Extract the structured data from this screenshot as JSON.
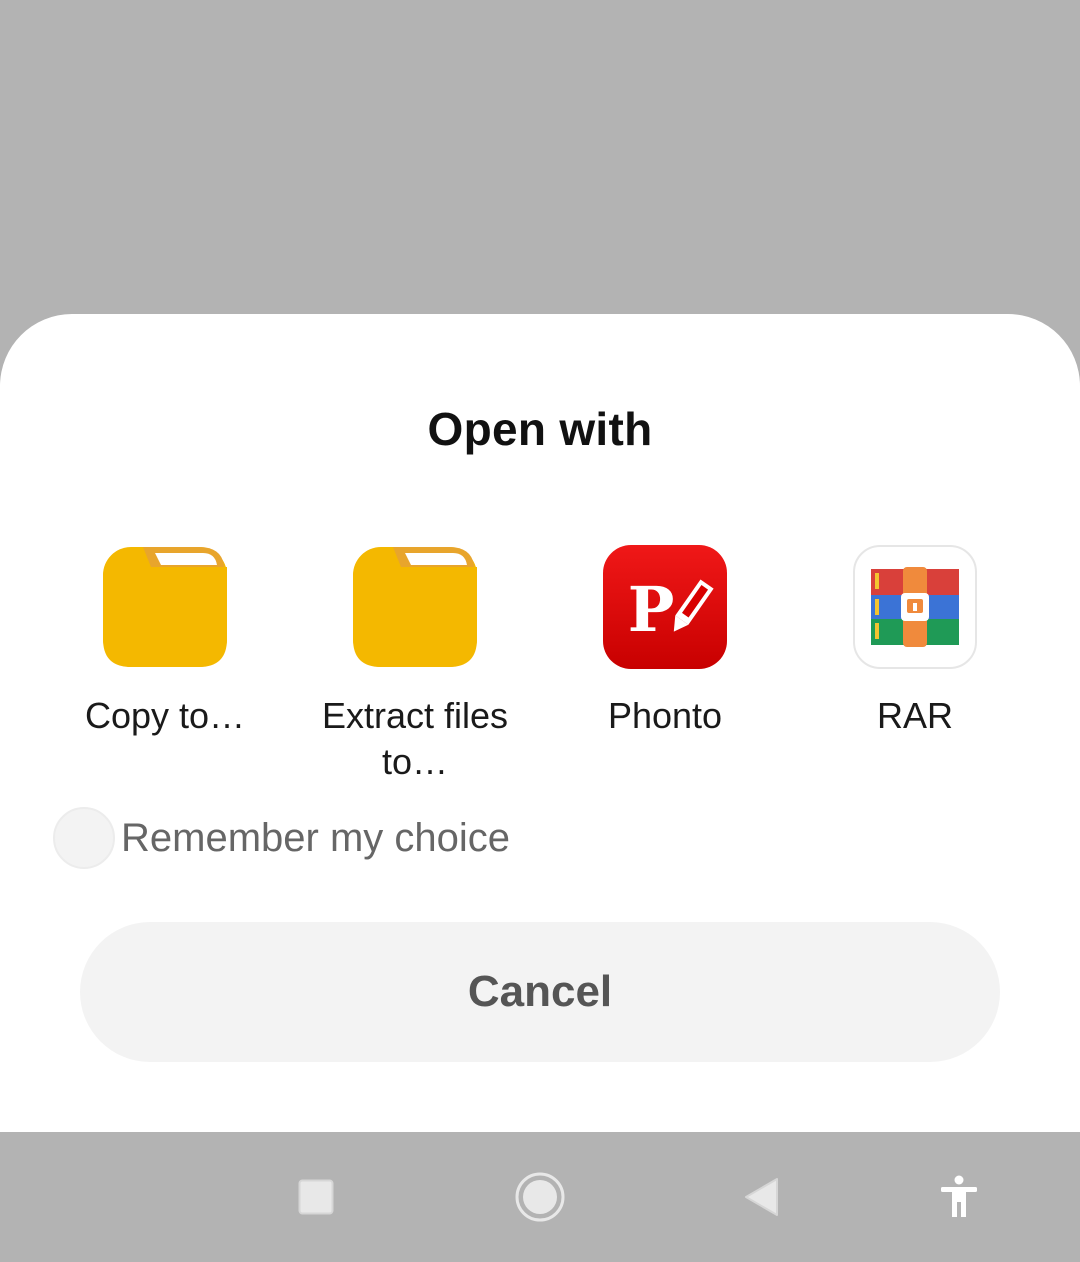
{
  "dialog": {
    "title": "Open with"
  },
  "apps": [
    {
      "label": "Copy to…",
      "icon": "folder-icon"
    },
    {
      "label": "Extract files to…",
      "icon": "folder-icon"
    },
    {
      "label": "Phonto",
      "icon": "phonto-app-icon"
    },
    {
      "label": "RAR",
      "icon": "rar-app-icon"
    }
  ],
  "remember": {
    "label": "Remember my choice",
    "checked": false
  },
  "cancel": {
    "label": "Cancel"
  },
  "navbar": {
    "buttons": [
      "recents-icon",
      "home-icon",
      "back-icon",
      "accessibility-icon"
    ]
  },
  "colors": {
    "scrim": "#b3b3b3",
    "sheet": "#ffffff",
    "folder": "#f4b800",
    "phonto": "#d90000",
    "button_bg": "#f3f3f3"
  }
}
